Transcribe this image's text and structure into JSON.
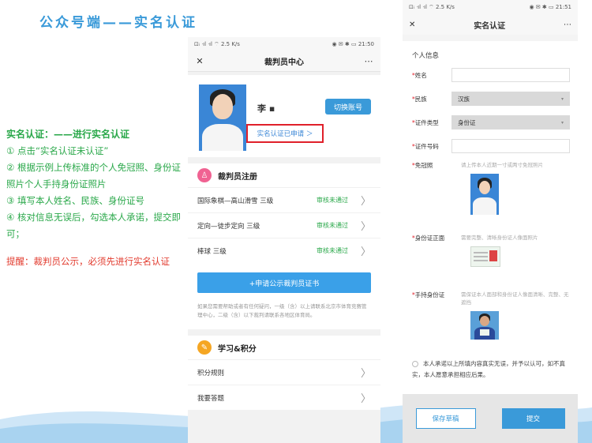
{
  "slide": {
    "title": "公众号端——实名认证"
  },
  "notes": {
    "heading": "实名认证：——进行实名认证",
    "steps": [
      "① 点击“实名认证未认证”",
      "② 根据示例上传标准的个人免冠照、身份证照片个人手持身份证照片",
      "③ 填写本人姓名、民族、身份证号",
      "④ 核对信息无误后，勾选本人承诺，提交即可；"
    ],
    "reminder": "提醒：裁判员公示，必须先进行实名认证"
  },
  "phone1": {
    "status_left": "⊡ᵢ ᐧıl ᐧıl ⌔ 2.5 K/s",
    "status_right": "◉ ✉ ✱ ▭ 21:50",
    "nav_title": "裁判员中心",
    "close_icon": "close-icon",
    "more_icon": "more-icon",
    "profile_name": "李 ▪",
    "switch_label": "切换账号",
    "verify_label": "实名认证已申请 ＞",
    "referee_section": {
      "title": "裁判员注册",
      "icon": "person-icon",
      "icon_color": "#f06292",
      "rows": [
        {
          "label": "国际象棋—高山滑雪 三级",
          "status": "审核未通过"
        },
        {
          "label": "定向—徒步定向 三级",
          "status": "审核未通过"
        },
        {
          "label": "棒球 三级",
          "status": "审核未通过"
        }
      ],
      "apply_label": "+申请公示裁判员证书",
      "note": "如果您需要帮助或者有任何疑问，一级（含）以上请联系北京市体育竞赛管理中心，二级（含）以下裁判请联系各地区体育局。"
    },
    "study_section": {
      "title": "学习&积分",
      "icon": "study-icon",
      "icon_color": "#f5a623",
      "rows": [
        {
          "label": "积分规则"
        },
        {
          "label": "我要答题"
        }
      ]
    }
  },
  "phone2": {
    "status_left": "⊡ᵢ ᐧıl ᐧıl ⌔ 2.5 K/s",
    "status_right": "◉ ✉ ✱ ▭ 21:51",
    "nav_title": "实名认证",
    "group_title": "个人信息",
    "fields": {
      "name_label": "姓名",
      "ethnicity_label": "民族",
      "ethnicity_value": "汉族",
      "id_type_label": "证件类型",
      "id_type_value": "身份证",
      "id_number_label": "证件号码"
    },
    "photos": {
      "headshot_label": "免冠照",
      "headshot_hint": "请上传本人近期一寸或两寸免冠照片",
      "id_front_label": "身份证正面",
      "id_front_hint": "需要完整、清晰身份证人像面照片",
      "handheld_label": "手持身份证",
      "handheld_hint": "需保证本人面部和身份证人像面清晰、完整、无遮挡"
    },
    "agreement": "本人承诺以上所填内容真实无误，并予以认可，如不真实，本人愿意承担相应后果。",
    "save_label": "保存草稿",
    "submit_label": "提交"
  },
  "colors": {
    "accent": "#3a9ad9",
    "notes_green": "#2aa84a",
    "reminder_red": "#e23b2e",
    "highlight_border": "#e0202a"
  }
}
